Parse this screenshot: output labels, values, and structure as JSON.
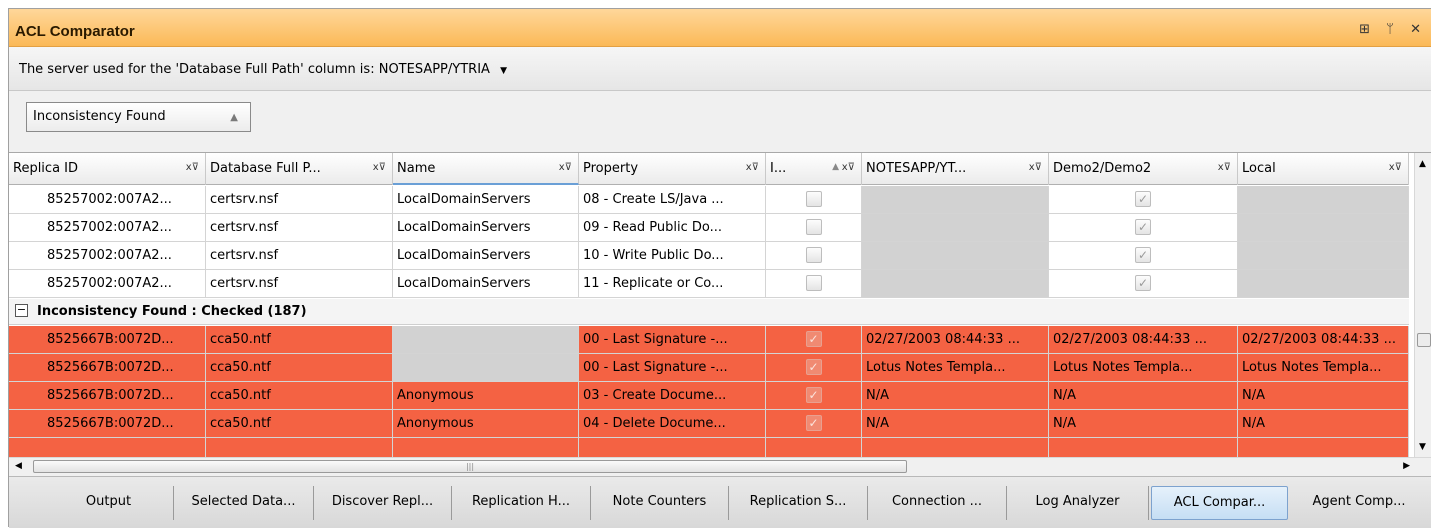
{
  "panel": {
    "title": "ACL Comparator",
    "title_buttons": "⊞ ᛘ ✕"
  },
  "server": {
    "label": "The server used for the 'Database Full Path' column is:",
    "value": "NOTESAPP/YTRIA"
  },
  "group_by": {
    "label": "Inconsistency Found"
  },
  "columns": [
    {
      "label": "Replica ID"
    },
    {
      "label": "Database Full P..."
    },
    {
      "label": "Name"
    },
    {
      "label": "Property"
    },
    {
      "label": "I..."
    },
    {
      "label": "NOTESAPP/YT..."
    },
    {
      "label": "Demo2/Demo2"
    },
    {
      "label": "Local"
    }
  ],
  "rows_top": [
    {
      "replica": "85257002:007A2...",
      "path": "certsrv.nsf",
      "name": "LocalDomainServers",
      "property": "08 - Create LS/Java ..."
    },
    {
      "replica": "85257002:007A2...",
      "path": "certsrv.nsf",
      "name": "LocalDomainServers",
      "property": "09 - Read Public Do..."
    },
    {
      "replica": "85257002:007A2...",
      "path": "certsrv.nsf",
      "name": "LocalDomainServers",
      "property": "10 - Write Public Do..."
    },
    {
      "replica": "85257002:007A2...",
      "path": "certsrv.nsf",
      "name": "LocalDomainServers",
      "property": "11 - Replicate or Co..."
    }
  ],
  "group": {
    "label": "Inconsistency Found : Checked (187)"
  },
  "rows_red": [
    {
      "replica": "8525667B:0072D...",
      "path": "cca50.ntf",
      "name": "",
      "property": "00 - Last Signature -...",
      "notesapp": "02/27/2003 08:44:33 ...",
      "demo2": "02/27/2003 08:44:33 ...",
      "local": "02/27/2003 08:44:33 ..."
    },
    {
      "replica": "8525667B:0072D...",
      "path": "cca50.ntf",
      "name": "",
      "property": "00 - Last Signature -...",
      "notesapp": "Lotus Notes Templa...",
      "demo2": "Lotus Notes Templa...",
      "local": "Lotus Notes Templa..."
    },
    {
      "replica": "8525667B:0072D...",
      "path": "cca50.ntf",
      "name": "Anonymous",
      "property": "03 - Create Docume...",
      "notesapp": "N/A",
      "demo2": "N/A",
      "local": "N/A"
    },
    {
      "replica": "8525667B:0072D...",
      "path": "cca50.ntf",
      "name": "Anonymous",
      "property": "04 - Delete Docume...",
      "notesapp": "N/A",
      "demo2": "N/A",
      "local": "N/A"
    }
  ],
  "tabs": [
    {
      "label": "Output"
    },
    {
      "label": "Selected Data..."
    },
    {
      "label": "Discover Repl..."
    },
    {
      "label": "Replication H..."
    },
    {
      "label": "Note Counters"
    },
    {
      "label": "Replication S..."
    },
    {
      "label": "Connection ..."
    },
    {
      "label": "Log Analyzer"
    },
    {
      "label": "ACL Compar..."
    },
    {
      "label": "Agent Comp..."
    }
  ]
}
